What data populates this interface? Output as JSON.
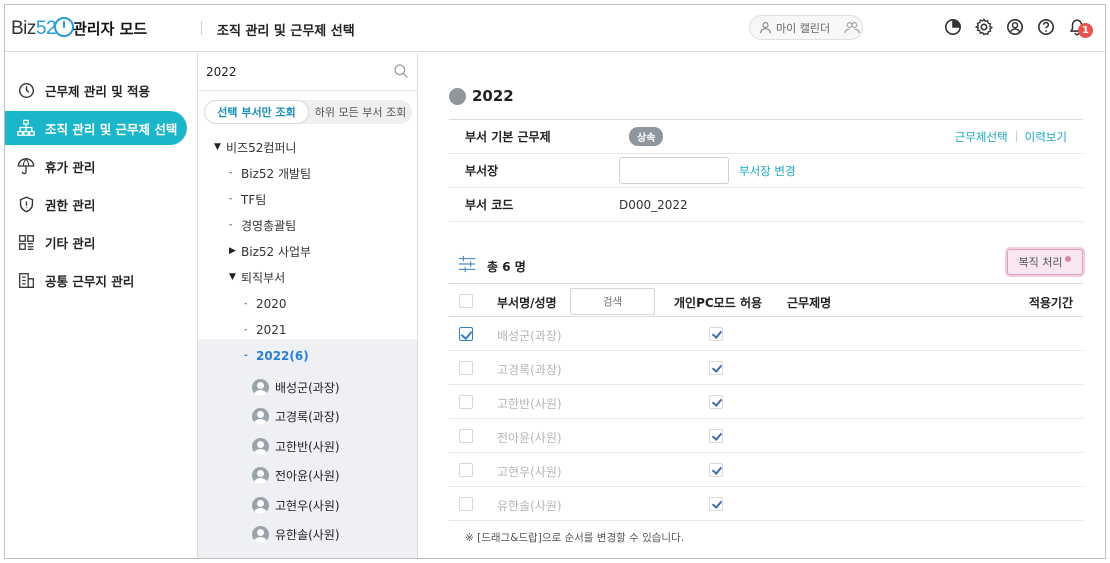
{
  "header": {
    "logo_text": "Biz52",
    "mode": "관리자 모드",
    "page_title": "조직 관리 및 근무제 선택",
    "my_calendar": "마이 캘린더",
    "notification_count": "1"
  },
  "nav": {
    "items": [
      {
        "label": "근무제 관리 및 적용",
        "icon": "clock-icon"
      },
      {
        "label": "조직 관리 및 근무제 선택",
        "icon": "org-chart-icon",
        "active": true
      },
      {
        "label": "휴가 관리",
        "icon": "umbrella-icon"
      },
      {
        "label": "권한 관리",
        "icon": "shield-icon"
      },
      {
        "label": "기타 관리",
        "icon": "grid-icon"
      },
      {
        "label": "공통 근무지 관리",
        "icon": "building-icon"
      }
    ]
  },
  "tree": {
    "search_value": "2022",
    "seg_selected": "선택 부서만 조회",
    "seg_all": "하위 모든 부서 조회",
    "nodes": [
      {
        "label": "비즈52컴퍼니",
        "prefix": "▼"
      },
      {
        "label": "Biz52 개발팀",
        "prefix": "-"
      },
      {
        "label": "TF팀",
        "prefix": "-"
      },
      {
        "label": "경영총괄팀",
        "prefix": "-"
      },
      {
        "label": "Biz52 사업부",
        "prefix": "▶"
      },
      {
        "label": "퇴직부서",
        "prefix": "▼"
      },
      {
        "label": "2020",
        "prefix": "-"
      },
      {
        "label": "2021",
        "prefix": "-"
      },
      {
        "label": "2022(6)",
        "prefix": "-"
      }
    ],
    "members": [
      "배성군(과장)",
      "고경록(과장)",
      "고한반(사원)",
      "전아윤(사원)",
      "고현우(사원)",
      "유한솔(사원)"
    ]
  },
  "main": {
    "dept_name": "2022",
    "info": {
      "base_label": "부서 기본 근무제",
      "base_value": "상속",
      "select_link": "근무제선택",
      "history_link": "이력보기",
      "manager_label": "부서장",
      "manager_value": "",
      "manager_change": "부서장 변경",
      "code_label": "부서 코드",
      "code_value": "D000_2022"
    },
    "total": "총 6 명",
    "reinstate_button": "복직 처리",
    "table": {
      "col_name": "부서명/성명",
      "search_placeholder": "검색",
      "col_pc": "개인PC모드 허용",
      "col_work": "근무제명",
      "col_period": "적용기간",
      "rows": [
        {
          "name": "배성군(과장)",
          "checked": true,
          "pc": true
        },
        {
          "name": "고경록(과장)",
          "checked": false,
          "pc": true
        },
        {
          "name": "고한반(사원)",
          "checked": false,
          "pc": true
        },
        {
          "name": "전아윤(사원)",
          "checked": false,
          "pc": true
        },
        {
          "name": "고현우(사원)",
          "checked": false,
          "pc": true
        },
        {
          "name": "유한솔(사원)",
          "checked": false,
          "pc": true
        }
      ]
    },
    "note": "※ [드래그&드랍]으로 순서를 변경할 수 있습니다."
  }
}
